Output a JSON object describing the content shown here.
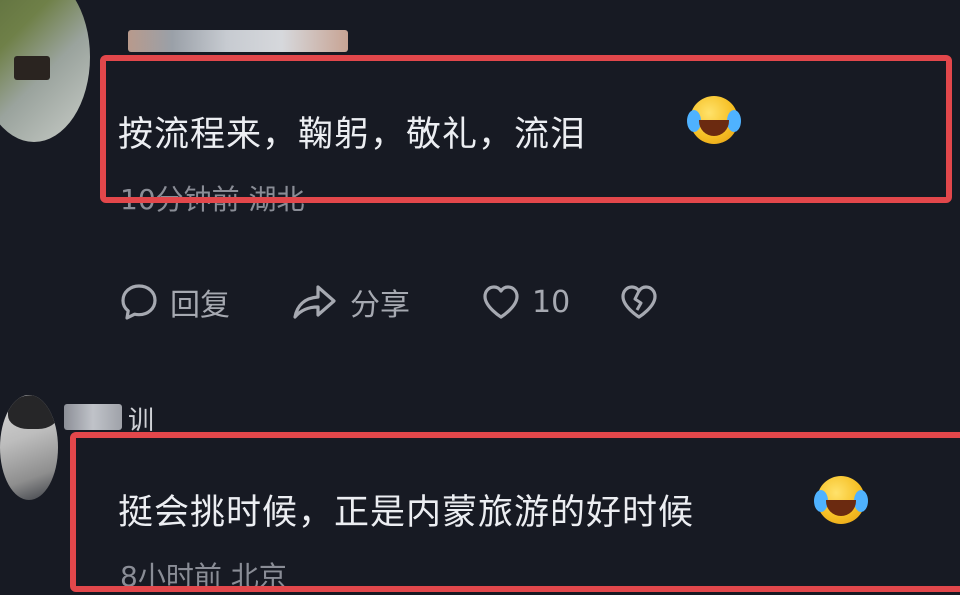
{
  "comments": [
    {
      "name_suffix": "",
      "text": "按流程来，鞠躬，敬礼，流泪",
      "emoji": "crying-laughing-emoji",
      "meta": "10分钟前 湖北",
      "actions": {
        "reply_label": "回复",
        "share_label": "分享",
        "like_count": "10"
      }
    },
    {
      "name_suffix": "训",
      "text": "挺会挑时候，正是内蒙旅游的好时候",
      "emoji": "crying-laughing-emoji",
      "meta": "8小时前 北京"
    }
  ],
  "colors": {
    "background": "#171a23",
    "highlight": "#e2474b",
    "meta_text": "#8a8d96",
    "action_text": "#a6a9b1"
  }
}
